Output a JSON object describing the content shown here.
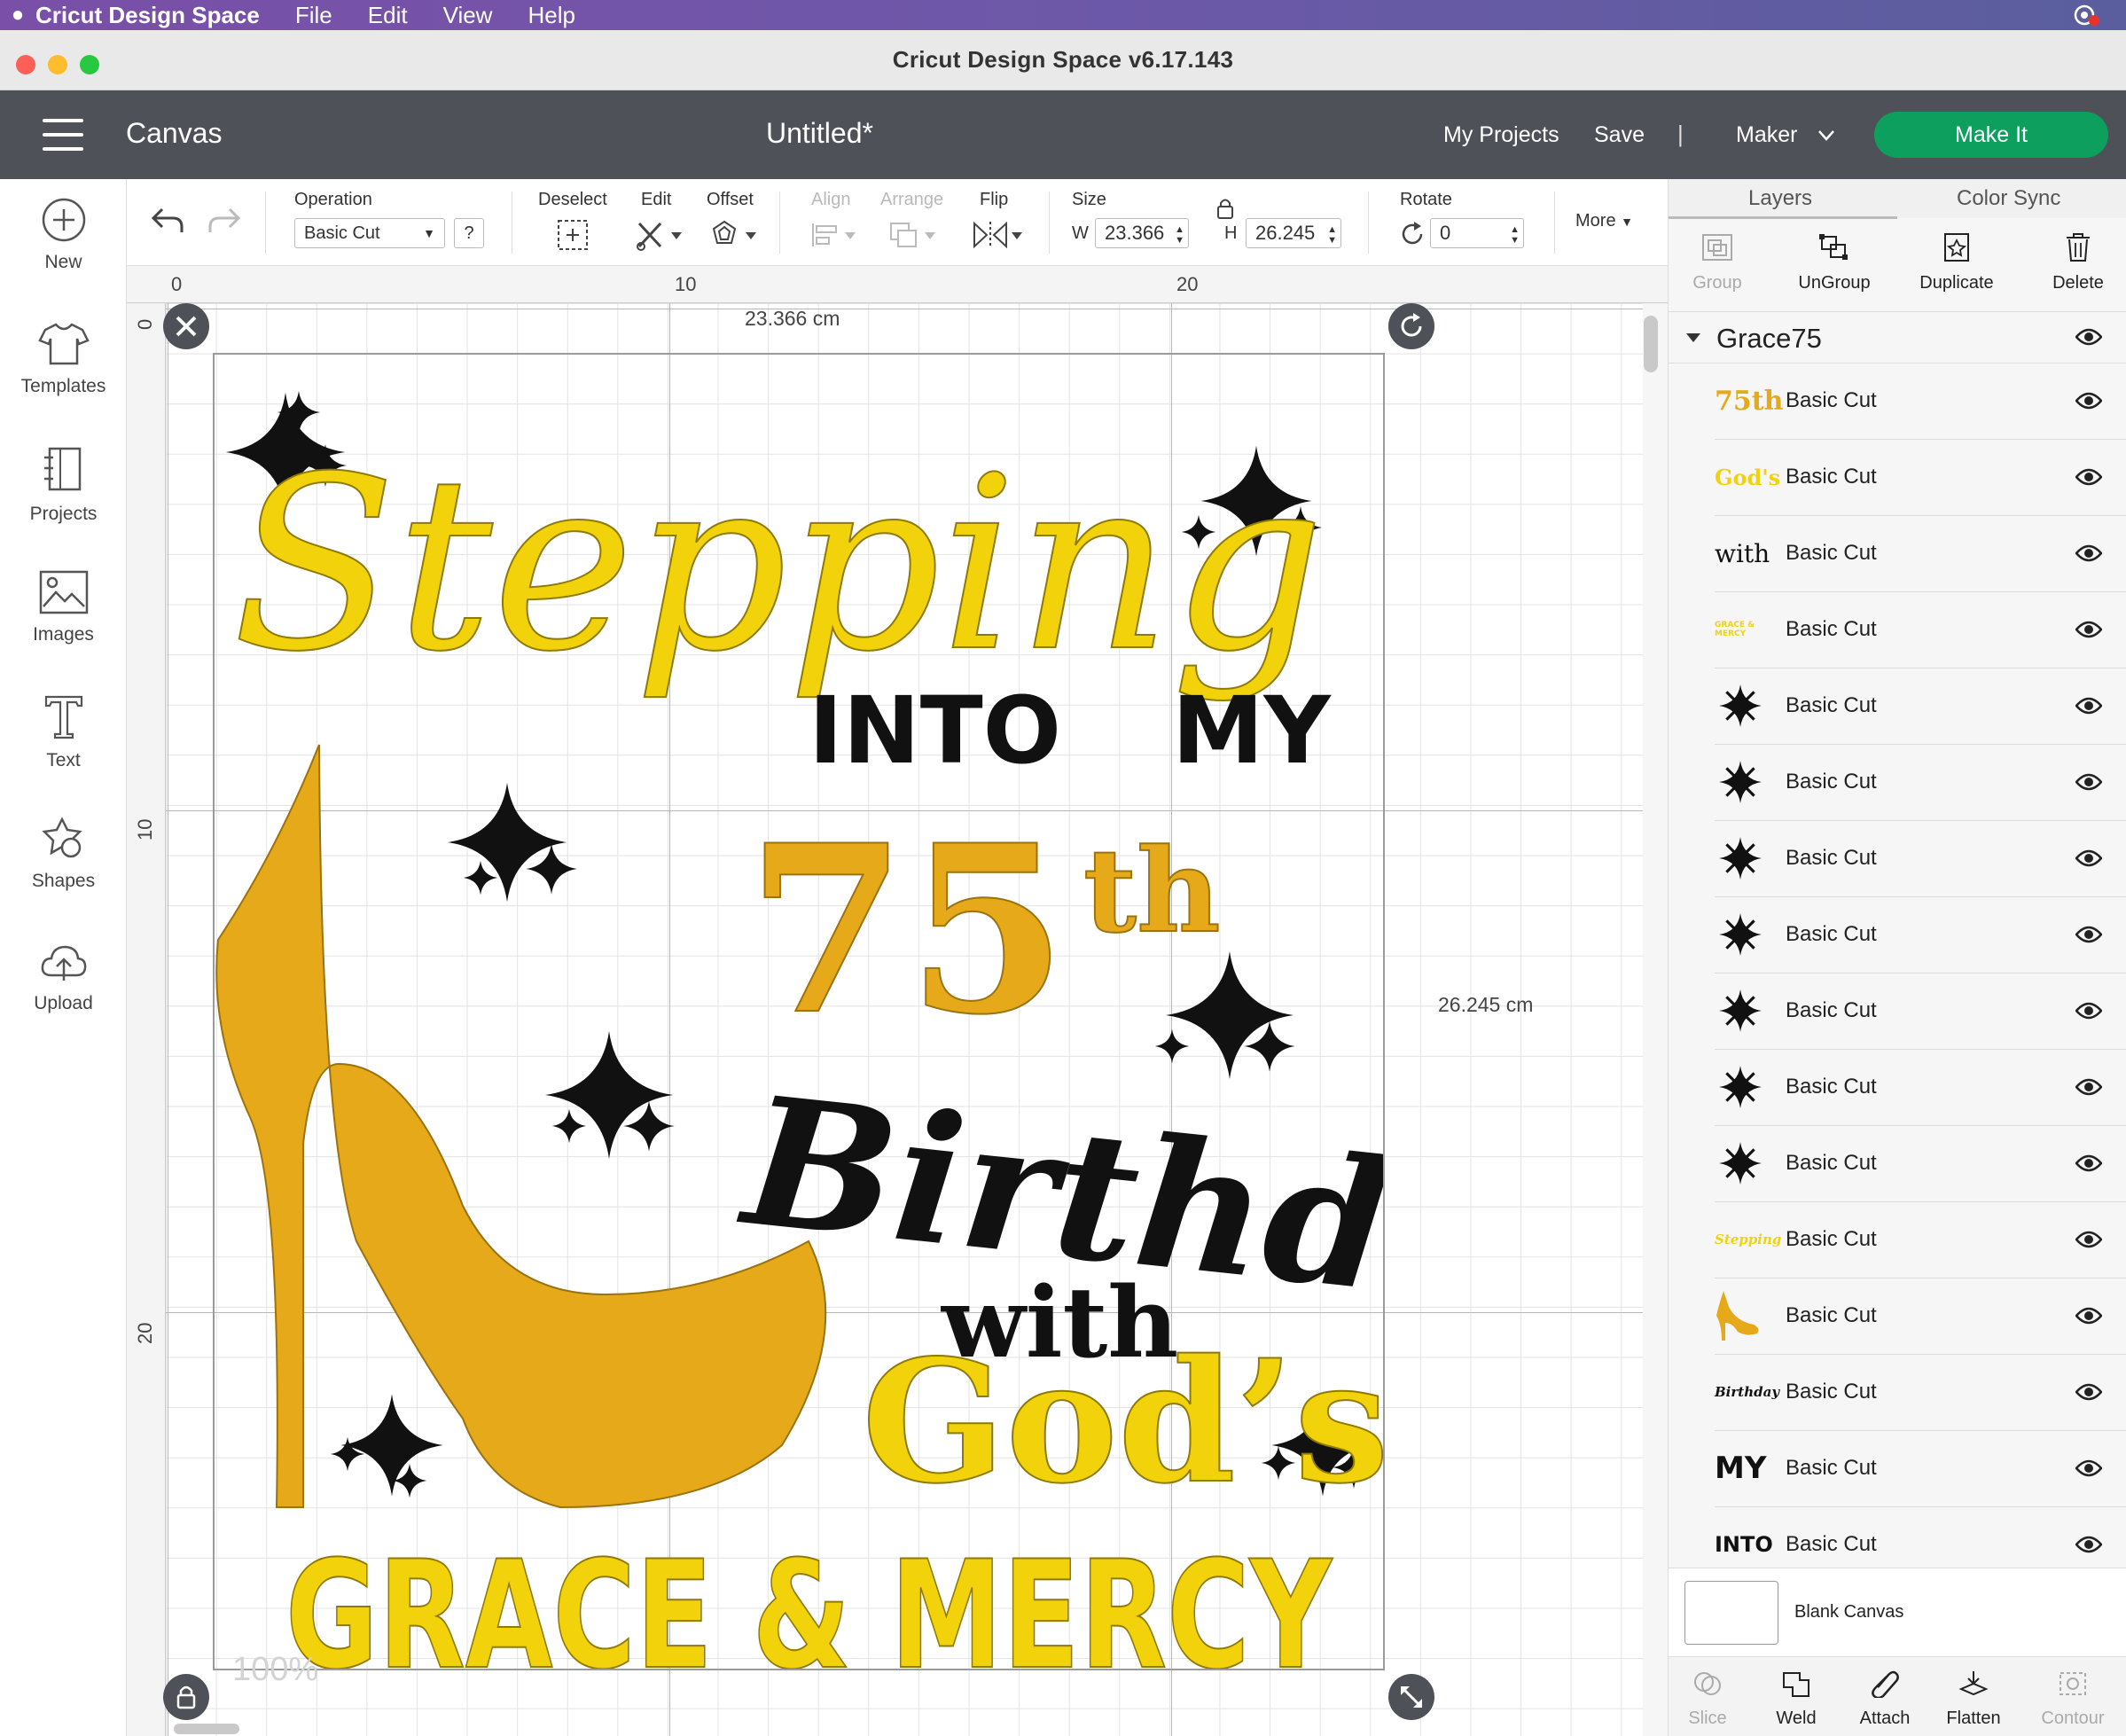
{
  "menubar": {
    "app_name": "Cricut Design Space",
    "items": [
      "File",
      "Edit",
      "View",
      "Help"
    ]
  },
  "window": {
    "title": "Cricut Design Space  v6.17.143"
  },
  "header": {
    "section": "Canvas",
    "doc_title": "Untitled*",
    "my_projects": "My Projects",
    "save": "Save",
    "separator": "|",
    "machine": "Maker",
    "make_it": "Make It"
  },
  "left_tools": [
    {
      "label": "New",
      "icon": "plus-circle-icon"
    },
    {
      "label": "Templates",
      "icon": "tshirt-icon"
    },
    {
      "label": "Projects",
      "icon": "notebook-icon"
    },
    {
      "label": "Images",
      "icon": "image-icon"
    },
    {
      "label": "Text",
      "icon": "text-t-icon"
    },
    {
      "label": "Shapes",
      "icon": "shapes-icon"
    },
    {
      "label": "Upload",
      "icon": "cloud-upload-icon"
    }
  ],
  "ops": {
    "operation_label": "Operation",
    "operation_value": "Basic Cut",
    "help": "?",
    "deselect": "Deselect",
    "edit": "Edit",
    "offset": "Offset",
    "align": "Align",
    "arrange": "Arrange",
    "flip": "Flip",
    "size": "Size",
    "w_label": "W",
    "w_value": "23.366",
    "h_label": "H",
    "h_value": "26.245",
    "rotate": "Rotate",
    "rotate_value": "0",
    "more": "More"
  },
  "rulers": {
    "top": [
      "0",
      "10",
      "20"
    ],
    "left": [
      "0",
      "10",
      "20"
    ]
  },
  "canvas": {
    "width_label": "23.366 cm",
    "height_label": "26.245 cm",
    "zoom": "100%"
  },
  "design_text": {
    "stepping": "Stepping",
    "into": "INTO",
    "my": "MY",
    "num": "75",
    "ordinal": "th",
    "birthday": "Birthday",
    "with": "with",
    "gods": "God’s",
    "grace": "GRACE & MERCY"
  },
  "colors": {
    "yellow": "#f2d20a",
    "gold": "#e5a91a",
    "black": "#111111",
    "make_it_green": "#0d9f5d",
    "header_bg": "#4e5157"
  },
  "right_panel": {
    "tabs": [
      "Layers",
      "Color Sync"
    ],
    "actions": [
      {
        "label": "Group",
        "enabled": false
      },
      {
        "label": "UnGroup",
        "enabled": true
      },
      {
        "label": "Duplicate",
        "enabled": true
      },
      {
        "label": "Delete",
        "enabled": true
      }
    ],
    "group_name": "Grace75",
    "layers": [
      {
        "thumb": "75th",
        "thumb_color": "#e5a91a",
        "op": "Basic Cut"
      },
      {
        "thumb": "God's",
        "thumb_color": "#f2d20a",
        "op": "Basic Cut"
      },
      {
        "thumb": "with",
        "thumb_color": "#111111",
        "op": "Basic Cut"
      },
      {
        "thumb": "GRACE & MERCY",
        "thumb_color": "#f2d20a",
        "op": "Basic Cut"
      },
      {
        "thumb": "star",
        "thumb_color": "#111111",
        "op": "Basic Cut"
      },
      {
        "thumb": "star",
        "thumb_color": "#111111",
        "op": "Basic Cut"
      },
      {
        "thumb": "star",
        "thumb_color": "#111111",
        "op": "Basic Cut"
      },
      {
        "thumb": "star",
        "thumb_color": "#111111",
        "op": "Basic Cut"
      },
      {
        "thumb": "star",
        "thumb_color": "#111111",
        "op": "Basic Cut"
      },
      {
        "thumb": "star",
        "thumb_color": "#111111",
        "op": "Basic Cut"
      },
      {
        "thumb": "star",
        "thumb_color": "#111111",
        "op": "Basic Cut"
      },
      {
        "thumb": "Stepping",
        "thumb_color": "#f2d20a",
        "op": "Basic Cut"
      },
      {
        "thumb": "shoe",
        "thumb_color": "#e5a91a",
        "op": "Basic Cut"
      },
      {
        "thumb": "Birthday",
        "thumb_color": "#111111",
        "op": "Basic Cut"
      },
      {
        "thumb": "MY",
        "thumb_color": "#111111",
        "op": "Basic Cut"
      },
      {
        "thumb": "INTO",
        "thumb_color": "#111111",
        "op": "Basic Cut"
      }
    ],
    "blank_canvas": "Blank Canvas",
    "bottom_actions": [
      {
        "label": "Slice",
        "enabled": false
      },
      {
        "label": "Weld",
        "enabled": true
      },
      {
        "label": "Attach",
        "enabled": true
      },
      {
        "label": "Flatten",
        "enabled": true
      },
      {
        "label": "Contour",
        "enabled": false
      }
    ]
  }
}
